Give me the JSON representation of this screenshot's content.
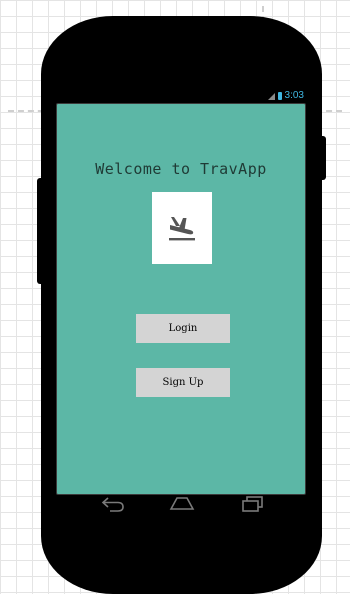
{
  "status_bar": {
    "time": "3:03",
    "icons": [
      "signal-icon",
      "battery-icon"
    ]
  },
  "screen": {
    "background_color": "#5cb7a6",
    "title": "Welcome to TravApp",
    "logo_icon": "airplane-departure-icon"
  },
  "buttons": {
    "login_label": "Login",
    "signup_label": "Sign Up"
  },
  "nav_bar": {
    "icons": [
      "back-icon",
      "home-icon",
      "recent-apps-icon"
    ]
  }
}
